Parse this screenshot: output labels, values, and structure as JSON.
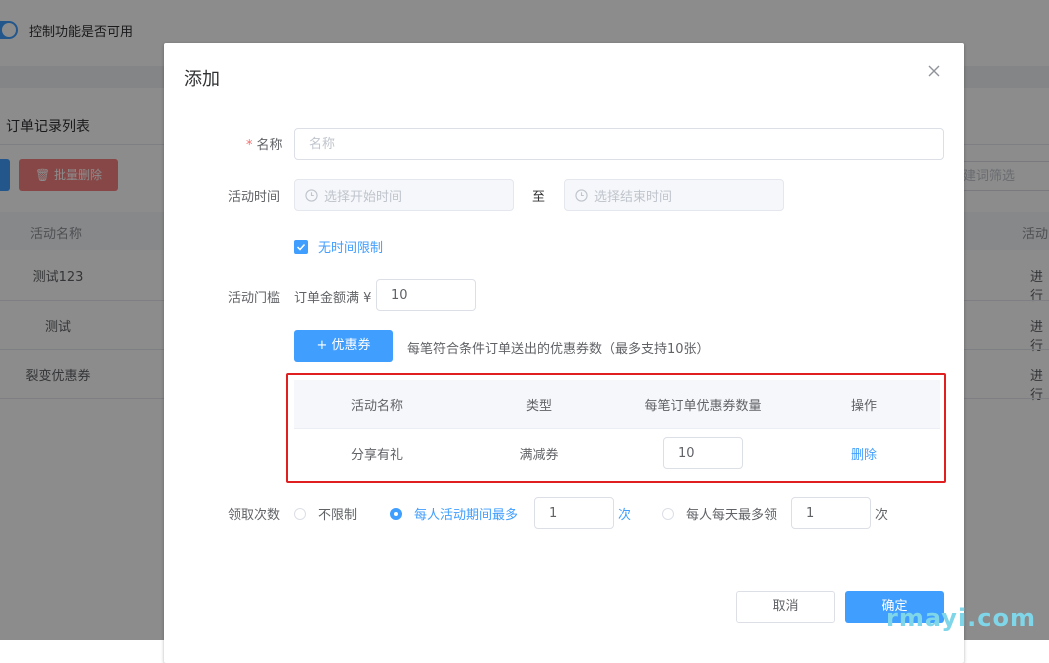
{
  "background": {
    "toggle_label": "控制功能是否可用",
    "list_title": "订单记录列表",
    "batch_delete_label": "批量删除",
    "filter_placeholder": "建词筛选",
    "column_name": "活动名称",
    "column_right": "活动",
    "rows": [
      {
        "name": "测试123",
        "status": "进行"
      },
      {
        "name": "测试",
        "status": "进行"
      },
      {
        "name": "裂变优惠券",
        "status": "进行"
      }
    ]
  },
  "dialog": {
    "title": "添加",
    "name_label": "名称",
    "name_required_mark": "*",
    "name_placeholder": "名称",
    "time_label": "活动时间",
    "start_placeholder": "选择开始时间",
    "end_placeholder": "选择结束时间",
    "time_separator": "至",
    "no_limit_checkbox": "无时间限制",
    "threshold_label": "活动门槛",
    "threshold_prefix": "订单金额满 ¥",
    "threshold_value": "10",
    "add_coupon_button": "+ 优惠券",
    "coupon_hint": "每笔符合条件订单送出的优惠券数（最多支持10张）",
    "coupon_table": {
      "headers": [
        "活动名称",
        "类型",
        "每笔订单优惠券数量",
        "操作"
      ],
      "rows": [
        {
          "name": "分享有礼",
          "type": "满减券",
          "quantity": "10",
          "action": "删除"
        }
      ]
    },
    "claim_label": "领取次数",
    "claim_options": {
      "unlimited": "不限制",
      "per_activity": "每人活动期间最多",
      "per_activity_value": "1",
      "per_activity_unit": "次",
      "per_day": "每人每天最多领",
      "per_day_value": "1",
      "per_day_unit": "次"
    },
    "cancel_button": "取消",
    "confirm_button": "确定"
  },
  "watermark": "rmayi.com",
  "colors": {
    "primary": "#409eff",
    "danger": "#f56c6c",
    "highlight": "#e02020"
  }
}
